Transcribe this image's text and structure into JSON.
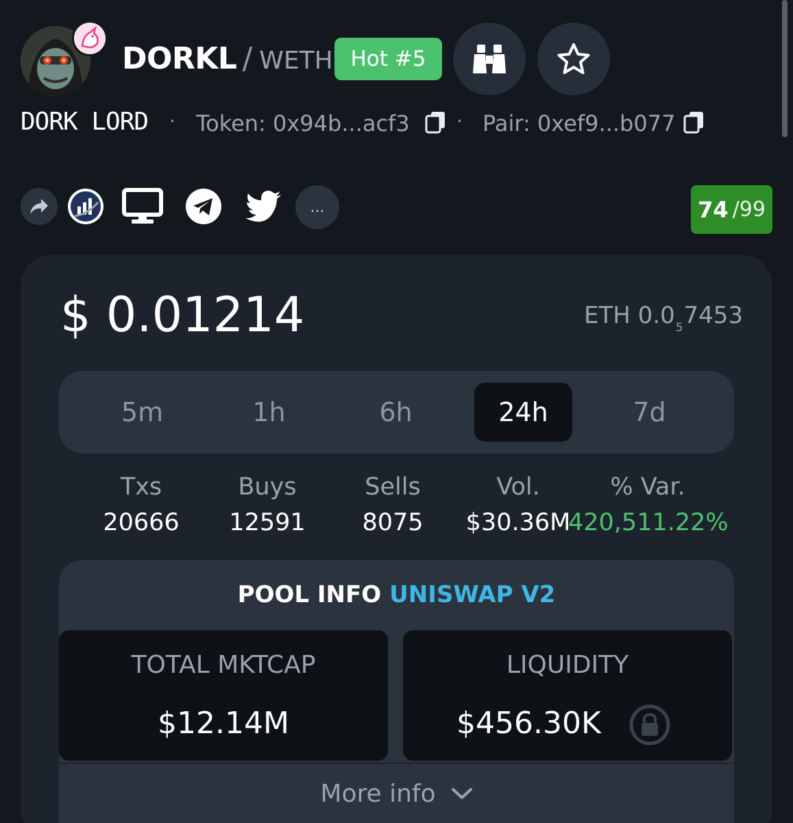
{
  "header": {
    "avatar_icon": "dork-lord-avatar-icon",
    "dex_icon": "uniswap-unicorn-icon",
    "base_symbol": "DORKL",
    "separator": "/",
    "quote_symbol": "WETH",
    "hot_badge": "Hot #5",
    "watch_icon": "binoculars-icon",
    "favorite_icon": "star-icon"
  },
  "meta": {
    "token_name": "DORK LORD",
    "dot": "·",
    "token_address": "Token: 0x94b...acf3",
    "pair_address": "Pair: 0xef9...b077"
  },
  "socials": {
    "items": [
      "share-icon",
      "etherscan-icon",
      "website-icon",
      "telegram-icon",
      "twitter-icon"
    ],
    "more_label": "..."
  },
  "score": {
    "value": "74",
    "max": "/99"
  },
  "price": {
    "usd": "$ 0.01214",
    "eth_prefix": "ETH 0.0",
    "eth_zeros": "5",
    "eth_digits": "7453"
  },
  "timeframes": {
    "tabs": [
      "5m",
      "1h",
      "6h",
      "24h",
      "7d"
    ],
    "active": "24h"
  },
  "stats": [
    {
      "label": "Txs",
      "value": "20666"
    },
    {
      "label": "Buys",
      "value": "12591"
    },
    {
      "label": "Sells",
      "value": "8075"
    },
    {
      "label": "Vol.",
      "value": "$30.36M"
    },
    {
      "label": "% Var.",
      "value": "420,511.22%"
    }
  ],
  "pool": {
    "label": "POOL INFO",
    "dex": "UNISWAP V2",
    "mktcap_label": "TOTAL MKTCAP",
    "mktcap_value": "$12.14M",
    "liquidity_label": "LIQUIDITY",
    "liquidity_value": "$456.30K",
    "lock_icon": "lock-icon"
  },
  "more_info": "More info",
  "colors": {
    "background": "#13171e",
    "card": "#1d232c",
    "panel": "#2b333e",
    "positive": "#4cc26e",
    "score": "#2f8d27",
    "dex_link": "#3fb6e4"
  }
}
